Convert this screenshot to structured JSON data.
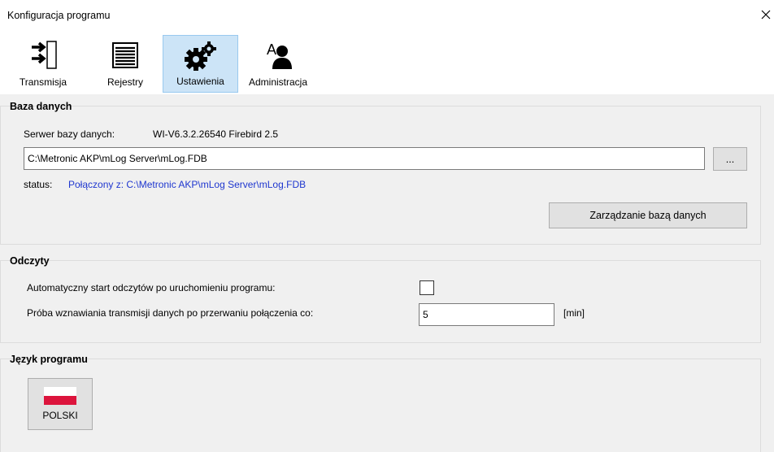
{
  "window": {
    "title": "Konfiguracja programu",
    "close_glyph": "✕"
  },
  "toolbar": {
    "items": [
      {
        "label": "Transmisja",
        "icon": "transmission-arrows-icon"
      },
      {
        "label": "Rejestry",
        "icon": "registry-list-icon"
      },
      {
        "label": "Ustawienia",
        "icon": "gears-icon",
        "selected": true
      },
      {
        "label": "Administracja",
        "icon": "user-admin-icon"
      }
    ]
  },
  "database": {
    "title": "Baza danych",
    "server_label": "Serwer bazy danych:",
    "server_value": "WI-V6.3.2.26540 Firebird 2.5",
    "path_value": "C:\\Metronic AKP\\mLog Server\\mLog.FDB",
    "browse_label": "...",
    "status_label": "status:",
    "status_value": "Połączony z: C:\\Metronic AKP\\mLog Server\\mLog.FDB",
    "manage_button": "Zarządzanie bazą danych"
  },
  "readings": {
    "title": "Odczyty",
    "auto_start_label": "Automatyczny start odczytów po uruchomieniu programu:",
    "auto_start_checked": false,
    "retry_label": "Próba wznawiania transmisji danych po przerwaniu połączenia co:",
    "retry_value": "5",
    "retry_unit": "[min]"
  },
  "language": {
    "title": "Język programu",
    "button_label": "POLSKI",
    "flag_colors": {
      "top": "#ffffff",
      "bottom": "#dc143c"
    }
  }
}
